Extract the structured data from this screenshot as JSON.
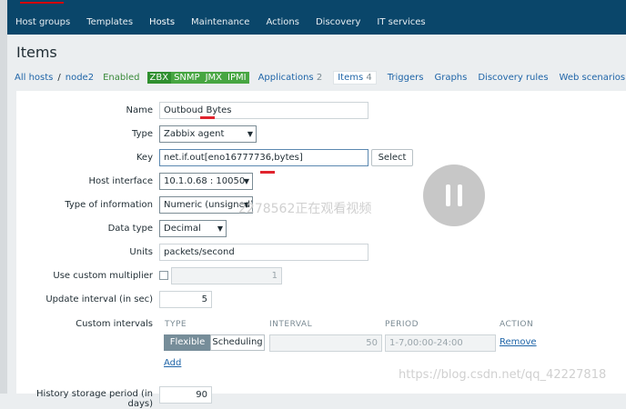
{
  "topnav": {
    "items": [
      {
        "label": "Host groups"
      },
      {
        "label": "Templates"
      },
      {
        "label": "Hosts"
      },
      {
        "label": "Maintenance"
      },
      {
        "label": "Actions"
      },
      {
        "label": "Discovery"
      },
      {
        "label": "IT services"
      }
    ],
    "active": "Hosts"
  },
  "page_title": "Items",
  "breadcrumb": {
    "all_hosts": "All hosts",
    "separator": "/",
    "host": "node2",
    "status": "Enabled",
    "tags": [
      "ZBX",
      "SNMP",
      "JMX",
      "IPMI"
    ]
  },
  "tabs": [
    {
      "label": "Applications",
      "count": "2"
    },
    {
      "label": "Items",
      "count": "4"
    },
    {
      "label": "Triggers",
      "count": ""
    },
    {
      "label": "Graphs",
      "count": ""
    },
    {
      "label": "Discovery rules",
      "count": ""
    },
    {
      "label": "Web scenarios",
      "count": ""
    }
  ],
  "form": {
    "name_label": "Name",
    "name_value": "Outboud Bytes",
    "type_label": "Type",
    "type_value": "Zabbix agent",
    "key_label": "Key",
    "key_value": "net.if.out[eno16777736,bytes]",
    "select_label": "Select",
    "host_interface_label": "Host interface",
    "host_interface_value": "10.1.0.68 : 10050",
    "type_info_label": "Type of information",
    "type_info_value": "Numeric (unsigned)",
    "data_type_label": "Data type",
    "data_type_value": "Decimal",
    "units_label": "Units",
    "units_value": "packets/second",
    "multiplier_label": "Use custom multiplier",
    "multiplier_value": "1",
    "update_interval_label": "Update interval (in sec)",
    "update_interval_value": "5",
    "custom_intervals_label": "Custom intervals",
    "history_label": "History storage period (in days)",
    "history_value": "90"
  },
  "custom_intervals": {
    "headers": [
      "TYPE",
      "INTERVAL",
      "PERIOD",
      "ACTION"
    ],
    "row": {
      "type_flexible": "Flexible",
      "type_scheduling": "Scheduling",
      "interval": "50",
      "period": "1-7,00:00-24:00",
      "action": "Remove"
    },
    "add_label": "Add"
  },
  "overlay": {
    "watermark_center": "2278562正在观看视频",
    "watermark_url": "https://blog.csdn.net/qq_42227818"
  },
  "colors": {
    "nav_bg": "#0a466a",
    "link": "#1f65a8",
    "enabled": "#3a8a3a",
    "tag_bg": "#47a642"
  }
}
